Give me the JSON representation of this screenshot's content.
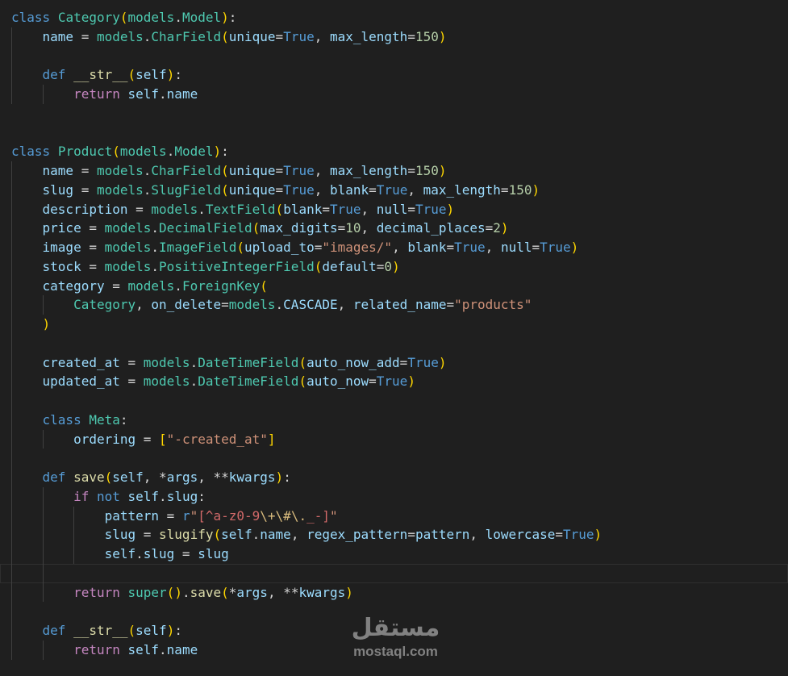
{
  "editor": {
    "indent_guides_per_level": 1,
    "active_line": 29,
    "lines": [
      {
        "indent": 0,
        "tokens": [
          [
            "kw",
            "class"
          ],
          [
            "pl",
            " "
          ],
          [
            "cls",
            "Category"
          ],
          [
            "b1",
            "("
          ],
          [
            "cls",
            "models"
          ],
          [
            "op",
            "."
          ],
          [
            "cls",
            "Model"
          ],
          [
            "b1",
            ")"
          ],
          [
            "op",
            ":"
          ]
        ]
      },
      {
        "indent": 1,
        "tokens": [
          [
            "var",
            "name"
          ],
          [
            "op",
            " = "
          ],
          [
            "cls",
            "models"
          ],
          [
            "op",
            "."
          ],
          [
            "cls",
            "CharField"
          ],
          [
            "b1",
            "("
          ],
          [
            "var",
            "unique"
          ],
          [
            "op",
            "="
          ],
          [
            "kw",
            "True"
          ],
          [
            "op",
            ", "
          ],
          [
            "var",
            "max_length"
          ],
          [
            "op",
            "="
          ],
          [
            "num",
            "150"
          ],
          [
            "b1",
            ")"
          ]
        ]
      },
      {
        "indent": 1,
        "tokens": []
      },
      {
        "indent": 1,
        "tokens": [
          [
            "kw",
            "def"
          ],
          [
            "pl",
            " "
          ],
          [
            "fn",
            "__str__"
          ],
          [
            "b1",
            "("
          ],
          [
            "var",
            "self"
          ],
          [
            "b1",
            ")"
          ],
          [
            "op",
            ":"
          ]
        ]
      },
      {
        "indent": 2,
        "tokens": [
          [
            "ctl",
            "return"
          ],
          [
            "pl",
            " "
          ],
          [
            "var",
            "self"
          ],
          [
            "op",
            "."
          ],
          [
            "var",
            "name"
          ]
        ]
      },
      {
        "indent": 0,
        "tokens": []
      },
      {
        "indent": 0,
        "tokens": []
      },
      {
        "indent": 0,
        "tokens": [
          [
            "kw",
            "class"
          ],
          [
            "pl",
            " "
          ],
          [
            "cls",
            "Product"
          ],
          [
            "b1",
            "("
          ],
          [
            "cls",
            "models"
          ],
          [
            "op",
            "."
          ],
          [
            "cls",
            "Model"
          ],
          [
            "b1",
            ")"
          ],
          [
            "op",
            ":"
          ]
        ]
      },
      {
        "indent": 1,
        "tokens": [
          [
            "var",
            "name"
          ],
          [
            "op",
            " = "
          ],
          [
            "cls",
            "models"
          ],
          [
            "op",
            "."
          ],
          [
            "cls",
            "CharField"
          ],
          [
            "b1",
            "("
          ],
          [
            "var",
            "unique"
          ],
          [
            "op",
            "="
          ],
          [
            "kw",
            "True"
          ],
          [
            "op",
            ", "
          ],
          [
            "var",
            "max_length"
          ],
          [
            "op",
            "="
          ],
          [
            "num",
            "150"
          ],
          [
            "b1",
            ")"
          ]
        ]
      },
      {
        "indent": 1,
        "tokens": [
          [
            "var",
            "slug"
          ],
          [
            "op",
            " = "
          ],
          [
            "cls",
            "models"
          ],
          [
            "op",
            "."
          ],
          [
            "cls",
            "SlugField"
          ],
          [
            "b1",
            "("
          ],
          [
            "var",
            "unique"
          ],
          [
            "op",
            "="
          ],
          [
            "kw",
            "True"
          ],
          [
            "op",
            ", "
          ],
          [
            "var",
            "blank"
          ],
          [
            "op",
            "="
          ],
          [
            "kw",
            "True"
          ],
          [
            "op",
            ", "
          ],
          [
            "var",
            "max_length"
          ],
          [
            "op",
            "="
          ],
          [
            "num",
            "150"
          ],
          [
            "b1",
            ")"
          ]
        ]
      },
      {
        "indent": 1,
        "tokens": [
          [
            "var",
            "description"
          ],
          [
            "op",
            " = "
          ],
          [
            "cls",
            "models"
          ],
          [
            "op",
            "."
          ],
          [
            "cls",
            "TextField"
          ],
          [
            "b1",
            "("
          ],
          [
            "var",
            "blank"
          ],
          [
            "op",
            "="
          ],
          [
            "kw",
            "True"
          ],
          [
            "op",
            ", "
          ],
          [
            "var",
            "null"
          ],
          [
            "op",
            "="
          ],
          [
            "kw",
            "True"
          ],
          [
            "b1",
            ")"
          ]
        ]
      },
      {
        "indent": 1,
        "tokens": [
          [
            "var",
            "price"
          ],
          [
            "op",
            " = "
          ],
          [
            "cls",
            "models"
          ],
          [
            "op",
            "."
          ],
          [
            "cls",
            "DecimalField"
          ],
          [
            "b1",
            "("
          ],
          [
            "var",
            "max_digits"
          ],
          [
            "op",
            "="
          ],
          [
            "num",
            "10"
          ],
          [
            "op",
            ", "
          ],
          [
            "var",
            "decimal_places"
          ],
          [
            "op",
            "="
          ],
          [
            "num",
            "2"
          ],
          [
            "b1",
            ")"
          ]
        ]
      },
      {
        "indent": 1,
        "tokens": [
          [
            "var",
            "image"
          ],
          [
            "op",
            " = "
          ],
          [
            "cls",
            "models"
          ],
          [
            "op",
            "."
          ],
          [
            "cls",
            "ImageField"
          ],
          [
            "b1",
            "("
          ],
          [
            "var",
            "upload_to"
          ],
          [
            "op",
            "="
          ],
          [
            "str",
            "\"images/\""
          ],
          [
            "op",
            ", "
          ],
          [
            "var",
            "blank"
          ],
          [
            "op",
            "="
          ],
          [
            "kw",
            "True"
          ],
          [
            "op",
            ", "
          ],
          [
            "var",
            "null"
          ],
          [
            "op",
            "="
          ],
          [
            "kw",
            "True"
          ],
          [
            "b1",
            ")"
          ]
        ]
      },
      {
        "indent": 1,
        "tokens": [
          [
            "var",
            "stock"
          ],
          [
            "op",
            " = "
          ],
          [
            "cls",
            "models"
          ],
          [
            "op",
            "."
          ],
          [
            "cls",
            "PositiveIntegerField"
          ],
          [
            "b1",
            "("
          ],
          [
            "var",
            "default"
          ],
          [
            "op",
            "="
          ],
          [
            "num",
            "0"
          ],
          [
            "b1",
            ")"
          ]
        ]
      },
      {
        "indent": 1,
        "tokens": [
          [
            "var",
            "category"
          ],
          [
            "op",
            " = "
          ],
          [
            "cls",
            "models"
          ],
          [
            "op",
            "."
          ],
          [
            "cls",
            "ForeignKey"
          ],
          [
            "b1",
            "("
          ]
        ]
      },
      {
        "indent": 2,
        "tokens": [
          [
            "cls",
            "Category"
          ],
          [
            "op",
            ", "
          ],
          [
            "var",
            "on_delete"
          ],
          [
            "op",
            "="
          ],
          [
            "cls",
            "models"
          ],
          [
            "op",
            "."
          ],
          [
            "var",
            "CASCADE"
          ],
          [
            "op",
            ", "
          ],
          [
            "var",
            "related_name"
          ],
          [
            "op",
            "="
          ],
          [
            "str",
            "\"products\""
          ]
        ]
      },
      {
        "indent": 1,
        "tokens": [
          [
            "b1",
            ")"
          ]
        ]
      },
      {
        "indent": 1,
        "tokens": []
      },
      {
        "indent": 1,
        "tokens": [
          [
            "var",
            "created_at"
          ],
          [
            "op",
            " = "
          ],
          [
            "cls",
            "models"
          ],
          [
            "op",
            "."
          ],
          [
            "cls",
            "DateTimeField"
          ],
          [
            "b1",
            "("
          ],
          [
            "var",
            "auto_now_add"
          ],
          [
            "op",
            "="
          ],
          [
            "kw",
            "True"
          ],
          [
            "b1",
            ")"
          ]
        ]
      },
      {
        "indent": 1,
        "tokens": [
          [
            "var",
            "updated_at"
          ],
          [
            "op",
            " = "
          ],
          [
            "cls",
            "models"
          ],
          [
            "op",
            "."
          ],
          [
            "cls",
            "DateTimeField"
          ],
          [
            "b1",
            "("
          ],
          [
            "var",
            "auto_now"
          ],
          [
            "op",
            "="
          ],
          [
            "kw",
            "True"
          ],
          [
            "b1",
            ")"
          ]
        ]
      },
      {
        "indent": 1,
        "tokens": []
      },
      {
        "indent": 1,
        "tokens": [
          [
            "kw",
            "class"
          ],
          [
            "pl",
            " "
          ],
          [
            "cls",
            "Meta"
          ],
          [
            "op",
            ":"
          ]
        ]
      },
      {
        "indent": 2,
        "tokens": [
          [
            "var",
            "ordering"
          ],
          [
            "op",
            " = "
          ],
          [
            "b1",
            "["
          ],
          [
            "str",
            "\"-created_at\""
          ],
          [
            "b1",
            "]"
          ]
        ]
      },
      {
        "indent": 1,
        "tokens": []
      },
      {
        "indent": 1,
        "tokens": [
          [
            "kw",
            "def"
          ],
          [
            "pl",
            " "
          ],
          [
            "fn",
            "save"
          ],
          [
            "b1",
            "("
          ],
          [
            "var",
            "self"
          ],
          [
            "op",
            ", *"
          ],
          [
            "var",
            "args"
          ],
          [
            "op",
            ", **"
          ],
          [
            "var",
            "kwargs"
          ],
          [
            "b1",
            ")"
          ],
          [
            "op",
            ":"
          ]
        ]
      },
      {
        "indent": 2,
        "tokens": [
          [
            "ctl",
            "if"
          ],
          [
            "pl",
            " "
          ],
          [
            "kw",
            "not"
          ],
          [
            "pl",
            " "
          ],
          [
            "var",
            "self"
          ],
          [
            "op",
            "."
          ],
          [
            "var",
            "slug"
          ],
          [
            "op",
            ":"
          ]
        ]
      },
      {
        "indent": 3,
        "tokens": [
          [
            "var",
            "pattern"
          ],
          [
            "op",
            " = "
          ],
          [
            "kw",
            "r"
          ],
          [
            "str",
            "\""
          ],
          [
            "rx",
            "[^a-z0-9"
          ],
          [
            "esc",
            "\\+\\#\\."
          ],
          [
            "rx",
            "_-]"
          ],
          [
            "str",
            "\""
          ]
        ]
      },
      {
        "indent": 3,
        "tokens": [
          [
            "var",
            "slug"
          ],
          [
            "op",
            " = "
          ],
          [
            "fn",
            "slugify"
          ],
          [
            "b1",
            "("
          ],
          [
            "var",
            "self"
          ],
          [
            "op",
            "."
          ],
          [
            "var",
            "name"
          ],
          [
            "op",
            ", "
          ],
          [
            "var",
            "regex_pattern"
          ],
          [
            "op",
            "="
          ],
          [
            "var",
            "pattern"
          ],
          [
            "op",
            ", "
          ],
          [
            "var",
            "lowercase"
          ],
          [
            "op",
            "="
          ],
          [
            "kw",
            "True"
          ],
          [
            "b1",
            ")"
          ]
        ]
      },
      {
        "indent": 3,
        "tokens": [
          [
            "var",
            "self"
          ],
          [
            "op",
            "."
          ],
          [
            "var",
            "slug"
          ],
          [
            "op",
            " = "
          ],
          [
            "var",
            "slug"
          ]
        ]
      },
      {
        "indent": 2,
        "tokens": []
      },
      {
        "indent": 2,
        "tokens": [
          [
            "ctl",
            "return"
          ],
          [
            "pl",
            " "
          ],
          [
            "cls",
            "super"
          ],
          [
            "b1",
            "("
          ],
          [
            "b1",
            ")"
          ],
          [
            "op",
            "."
          ],
          [
            "fn",
            "save"
          ],
          [
            "b1",
            "("
          ],
          [
            "op",
            "*"
          ],
          [
            "var",
            "args"
          ],
          [
            "op",
            ", **"
          ],
          [
            "var",
            "kwargs"
          ],
          [
            "b1",
            ")"
          ]
        ]
      },
      {
        "indent": 1,
        "tokens": []
      },
      {
        "indent": 1,
        "tokens": [
          [
            "kw",
            "def"
          ],
          [
            "pl",
            " "
          ],
          [
            "fn",
            "__str__"
          ],
          [
            "b1",
            "("
          ],
          [
            "var",
            "self"
          ],
          [
            "b1",
            ")"
          ],
          [
            "op",
            ":"
          ]
        ]
      },
      {
        "indent": 2,
        "tokens": [
          [
            "ctl",
            "return"
          ],
          [
            "pl",
            " "
          ],
          [
            "var",
            "self"
          ],
          [
            "op",
            "."
          ],
          [
            "var",
            "name"
          ]
        ]
      }
    ]
  },
  "watermark": {
    "logo_text": "مستقل",
    "domain_text": "mostaql.com"
  }
}
